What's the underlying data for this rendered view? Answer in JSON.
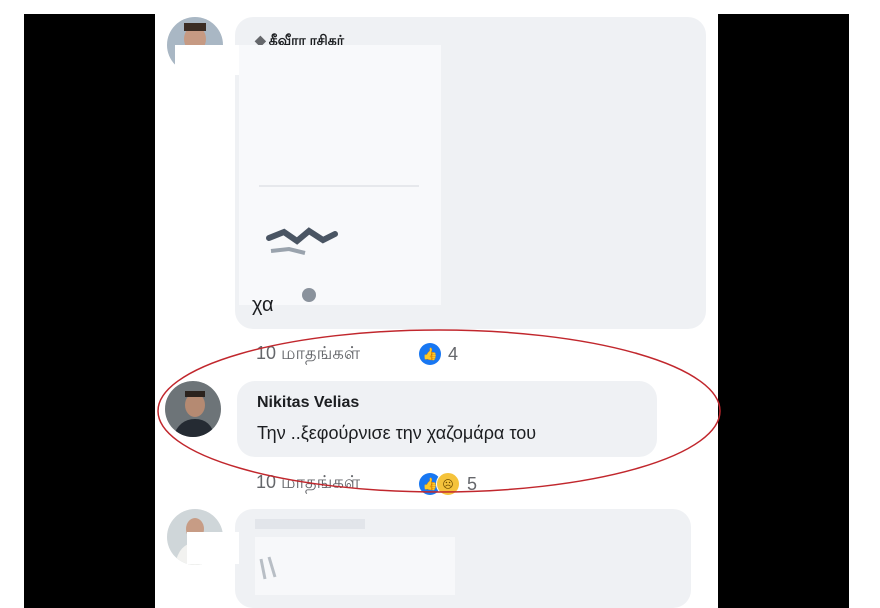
{
  "comments": [
    {
      "author": "கீவீரா ரசிகர்",
      "text": "χα",
      "time": "10 மாதங்கள்",
      "reaction_count": "4"
    },
    {
      "author": "Nikitas Velias",
      "text": "Την ..ξεφούρνισε την χαζομάρα του",
      "time": "10 மாதங்கள்",
      "reaction_count": "5"
    }
  ],
  "icons": {
    "author_badge": "diamond-icon",
    "reactions_first": [
      "like-icon"
    ],
    "reactions_second": [
      "like-icon",
      "sad-icon"
    ]
  },
  "colors": {
    "bubble": "#eff1f4",
    "like": "#1877f2",
    "highlight_ring": "#c1272d"
  }
}
